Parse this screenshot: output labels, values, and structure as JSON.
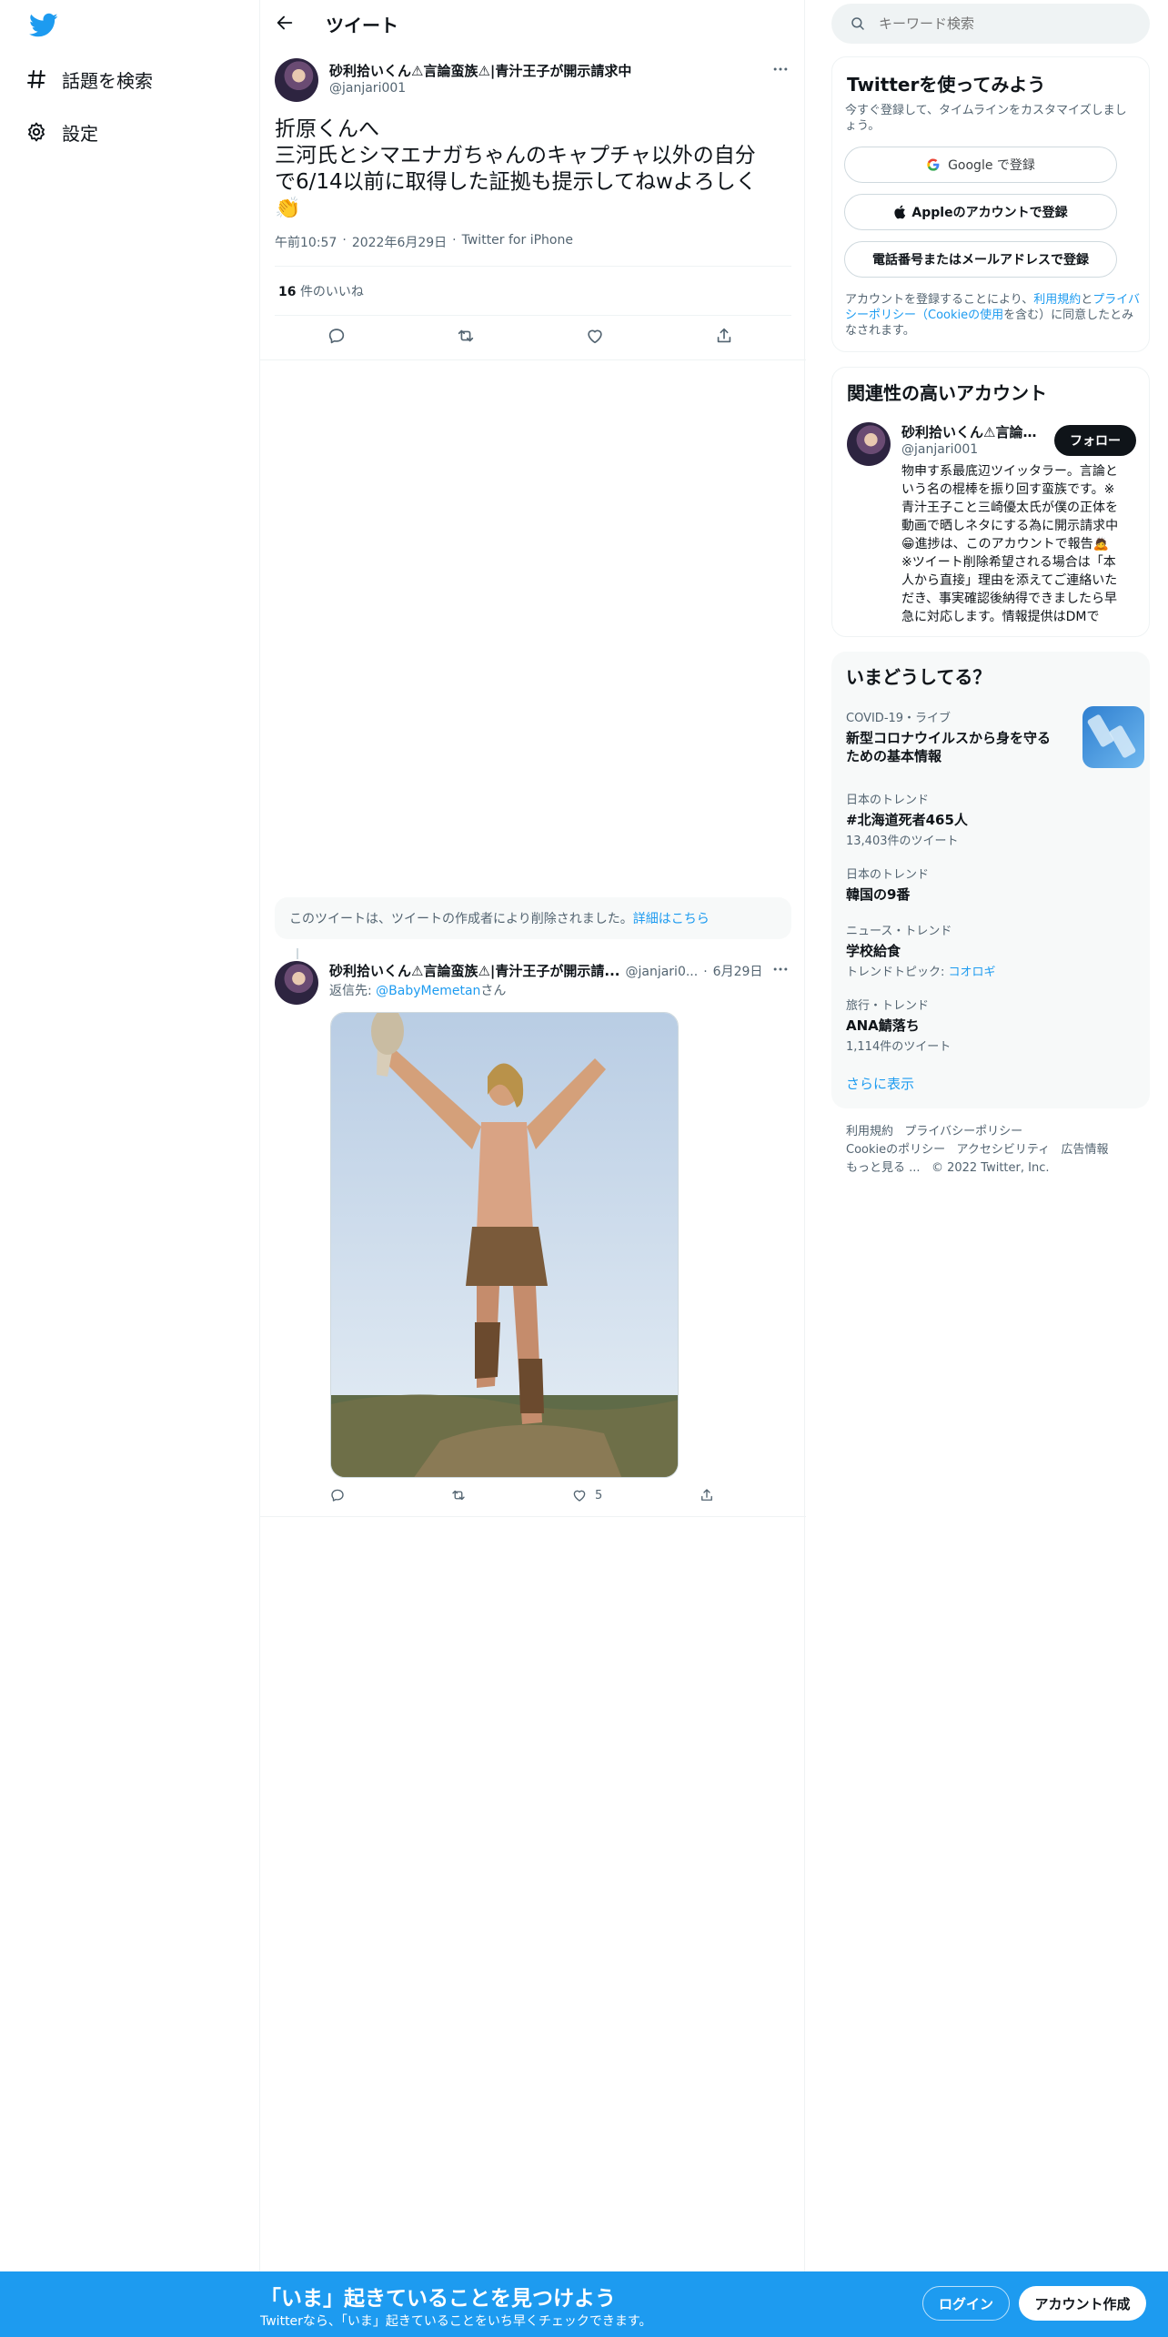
{
  "nav": {
    "explore_label": "話題を検索",
    "settings_label": "設定"
  },
  "header": {
    "title": "ツイート"
  },
  "tweet": {
    "display_name": "砂利拾いくん⚠言論蛮族⚠|青汁王子が開示請求中",
    "handle": "@janjari001",
    "line1": "折原くんへ",
    "line2": "三河氏とシマエナガちゃんのキャプチャ以外の自分",
    "line3": "で6/14以前に取得した証拠も提示してねwよろしく",
    "emoji": "👏",
    "time": "午前10:57",
    "date": "2022年6月29日",
    "source": "Twitter for iPhone",
    "likes_count": "16",
    "likes_label": "件のいいね"
  },
  "deleted_notice": {
    "text": "このツイートは、ツイートの作成者により削除されました。",
    "link": "詳細はこちら"
  },
  "reply": {
    "display_name": "砂利拾いくん⚠言論蛮族⚠|青汁王子が開示請...",
    "handle": "@janjari0...",
    "date": "6月29日",
    "reply_prefix": "返信先: ",
    "reply_to": "@BabyMemetan",
    "reply_suffix": "さん",
    "like_count": "5"
  },
  "search": {
    "placeholder": "キーワード検索"
  },
  "signup": {
    "title": "Twitterを使ってみよう",
    "subtitle": "今すぐ登録して、タイムラインをカスタマイズしましょう。",
    "google_label": "Google で登録",
    "apple_label": "Appleのアカウントで登録",
    "phone_label": "電話番号またはメールアドレスで登録",
    "legal_prefix": "アカウントを登録することにより、",
    "legal_terms": "利用規約",
    "legal_and": "と",
    "legal_privacy": "プライバシーポリシー",
    "legal_cookie": "（Cookieの使用",
    "legal_suffix": "を含む）に同意したとみなされます。"
  },
  "related": {
    "title": "関連性の高いアカウント",
    "name": "砂利拾いくん⚠言論...",
    "handle": "@janjari001",
    "follow_label": "フォロー",
    "bio": [
      "物申す系最底辺ツイッタラー。言論と",
      "いう名の棍棒を振り回す蛮族です。※",
      "青汁王子こと三崎優太氏が僕の正体を",
      "動画で晒しネタにする為に開示請求中",
      "😁進捗は、このアカウントで報告🙇",
      "※ツイート削除希望される場合は「本",
      "人から直接」理由を添えてご連絡いた",
      "だき、事実確認後納得できましたら早",
      "急に対応します。情報提供はDMで"
    ]
  },
  "trends": {
    "title": "いまどうしてる？",
    "items": [
      {
        "meta": "COVID-19・ライブ",
        "title": "新型コロナウイルスから身を守る",
        "title2": "ための基本情報",
        "sub": ""
      },
      {
        "meta": "日本のトレンド",
        "title": "#北海道死者465人",
        "title2": "",
        "sub": "13,403件のツイート"
      },
      {
        "meta": "日本のトレンド",
        "title": "韓国の9番",
        "title2": "",
        "sub": ""
      },
      {
        "meta": "ニュース・トレンド",
        "title": "学校給食",
        "title2": "",
        "sub": "トレンドトピック: ",
        "sub_link": "コオロギ"
      },
      {
        "meta": "旅行・トレンド",
        "title": "ANA鯖落ち",
        "title2": "",
        "sub": "1,114件のツイート"
      }
    ],
    "show_more": "さらに表示"
  },
  "footer": {
    "terms": "利用規約",
    "privacy": "プライバシーポリシー",
    "cookie": "Cookieのポリシー",
    "accessibility": "アクセシビリティ",
    "ads": "広告情報",
    "more": "もっと見る ...",
    "copyright": "© 2022 Twitter, Inc."
  },
  "bottom_bar": {
    "title": "「いま」起きていることを見つけよう",
    "subtitle": "Twitterなら、「いま」起きていることをいち早くチェックできます。",
    "login": "ログイン",
    "signup": "アカウント作成"
  },
  "colors": {
    "accent": "#1d9bf0",
    "text": "#0f1419",
    "muted": "#536471",
    "bg_card": "#f7f9f9"
  }
}
